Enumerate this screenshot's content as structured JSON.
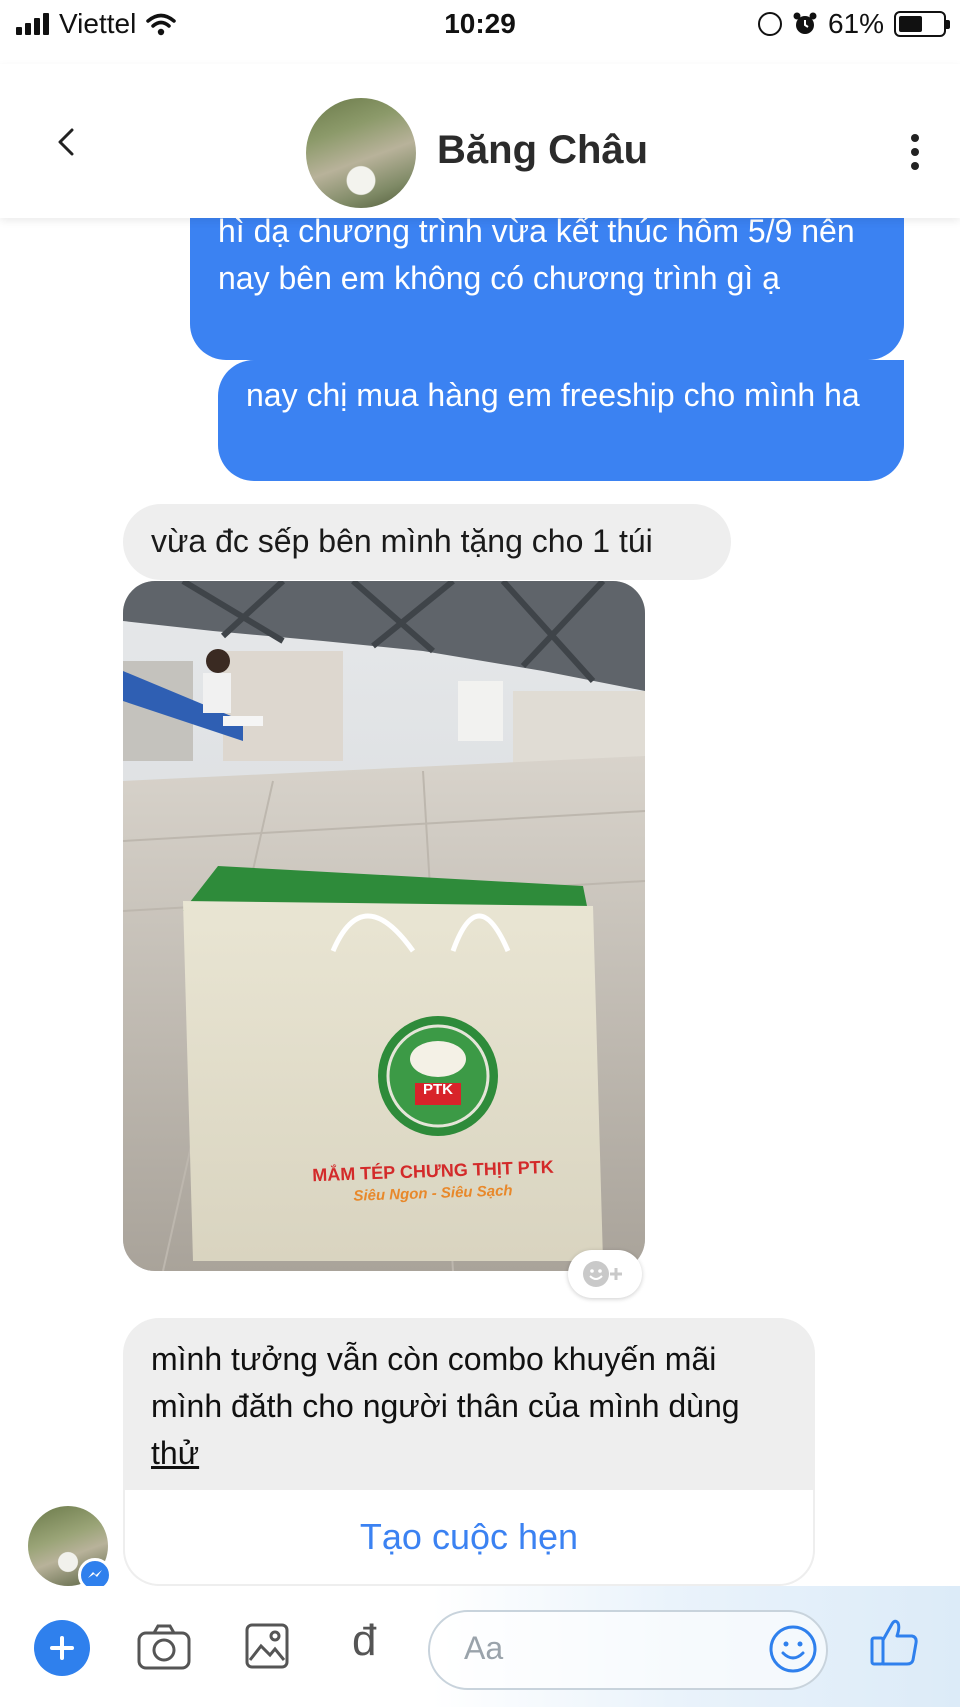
{
  "status_bar": {
    "carrier": "Viettel",
    "time": "10:29",
    "battery_percent": "61%",
    "battery_level": 0.61
  },
  "header": {
    "contact_name": "Băng Châu"
  },
  "messages": [
    {
      "direction": "outgoing",
      "text": "hì dạ chương trình vừa kết thúc hôm 5/9 nên nay bên em không có chương trình gì ạ"
    },
    {
      "direction": "outgoing",
      "text": "nay chị mua hàng em freeship cho mình ha"
    },
    {
      "direction": "incoming",
      "text": "vừa đc sếp bên mình tặng cho 1 túi"
    },
    {
      "direction": "incoming",
      "type": "photo",
      "bag_brand": "MẮM TÉP CHƯNG THỊT PTK",
      "bag_slogan": "Siêu Ngon - Siêu Sạch",
      "logo_text": "PTK"
    },
    {
      "direction": "incoming",
      "text_before": "mình tưởng vẫn còn combo khuyến mãi mình đăth cho người thân của mình dùng ",
      "text_underlined": "thử",
      "action_label": "Tạo cuộc hẹn"
    }
  ],
  "composer": {
    "placeholder": "Aa",
    "currency_symbol": "đ"
  },
  "colors": {
    "outgoing_bubble": "#3b82f2",
    "incoming_bubble": "#eeeeee",
    "accent": "#2f80ed"
  }
}
